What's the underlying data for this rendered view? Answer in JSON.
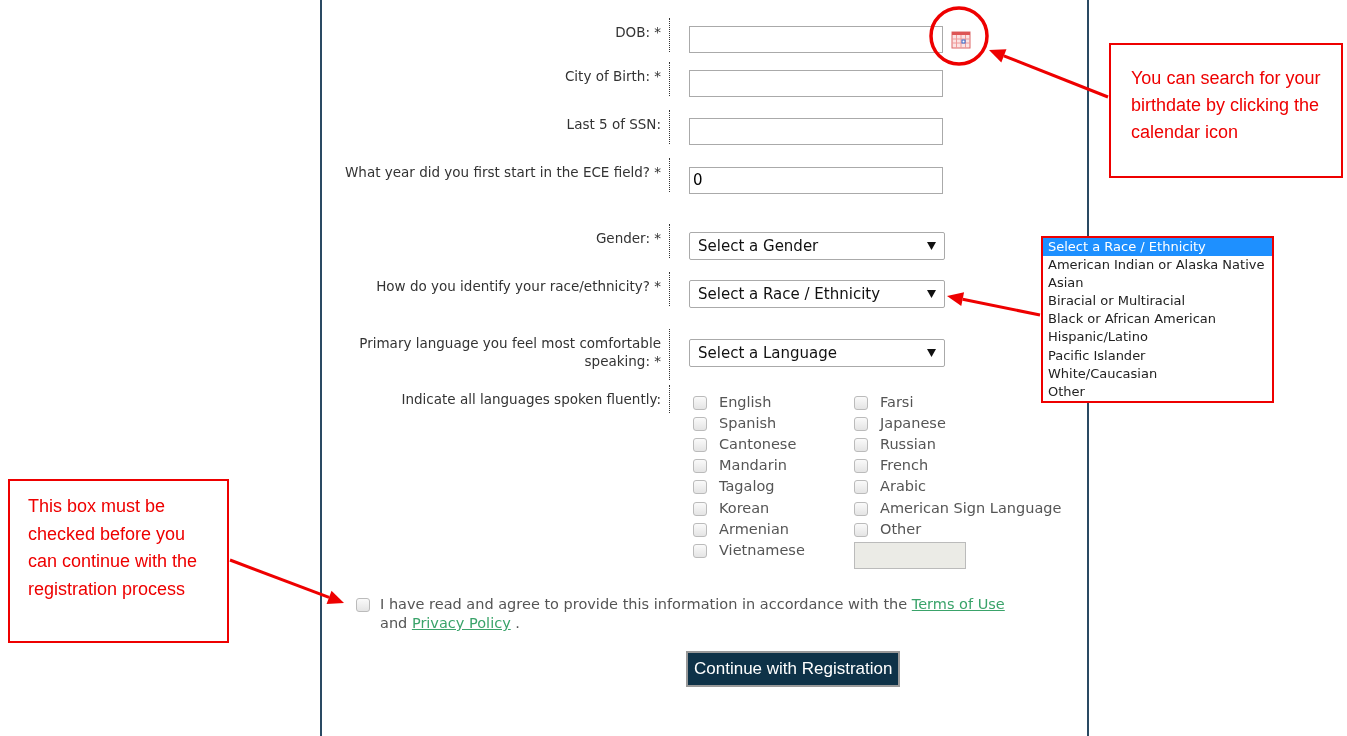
{
  "form": {
    "fields": [
      {
        "kind": "date",
        "label": "DOB: *"
      },
      {
        "kind": "text",
        "label": "City of Birth:  *"
      },
      {
        "kind": "text",
        "label": "Last 5 of SSN:"
      },
      {
        "kind": "text",
        "label": "What year did you first start in the ECE field? *",
        "value": "0"
      },
      {
        "kind": "select",
        "label": "Gender: *",
        "value": "Select a Gender"
      },
      {
        "kind": "select",
        "label": "How do you identify your race/ethnicity? *",
        "value": "Select a Race / Ethnicity"
      },
      {
        "kind": "select",
        "label": "Primary language you feel most comfortable speaking: *",
        "value": "Select a Language"
      }
    ],
    "languages": {
      "label": "Indicate all languages spoken fluently:",
      "columns": [
        [
          {
            "label": "English",
            "checked": false
          },
          {
            "label": "Spanish",
            "checked": false
          },
          {
            "label": "Cantonese",
            "checked": false
          },
          {
            "label": "Mandarin",
            "checked": false
          },
          {
            "label": "Tagalog",
            "checked": false
          },
          {
            "label": "Korean",
            "checked": false
          },
          {
            "label": "Armenian",
            "checked": false
          },
          {
            "label": "Vietnamese",
            "checked": false
          }
        ],
        [
          {
            "label": "Farsi",
            "checked": false
          },
          {
            "label": "Japanese",
            "checked": false
          },
          {
            "label": "Russian",
            "checked": false
          },
          {
            "label": "French",
            "checked": false
          },
          {
            "label": "Arabic",
            "checked": false
          },
          {
            "label": "American Sign Language",
            "checked": false
          },
          {
            "label": "Other",
            "checked": false
          }
        ]
      ],
      "other_field": {
        "disabled": true
      }
    },
    "agreement": {
      "checked": false,
      "text_before": "I have read and agree to provide this information in accordance with the",
      "terms_link": "Terms of Use",
      "text_middle": "and",
      "privacy_link": "Privacy Policy",
      "text_after": "."
    },
    "submit_button": "Continue with Registration"
  },
  "race_dropdown": {
    "options": [
      {
        "label": "Select a Race / Ethnicity",
        "selected": true
      },
      {
        "label": "American Indian or Alaska Native",
        "selected": false
      },
      {
        "label": "Asian",
        "selected": false
      },
      {
        "label": "Biracial or Multiracial",
        "selected": false
      },
      {
        "label": "Black or African American",
        "selected": false
      },
      {
        "label": "Hispanic/Latino",
        "selected": false
      },
      {
        "label": "Pacific Islander",
        "selected": false
      },
      {
        "label": "White/Caucasian",
        "selected": false
      },
      {
        "label": "Other",
        "selected": false
      }
    ]
  },
  "callouts": [
    {
      "text": "You can search for your birthdate by clicking the calendar icon"
    },
    {
      "text": "This box must be checked before you can continue with the registration process"
    }
  ]
}
